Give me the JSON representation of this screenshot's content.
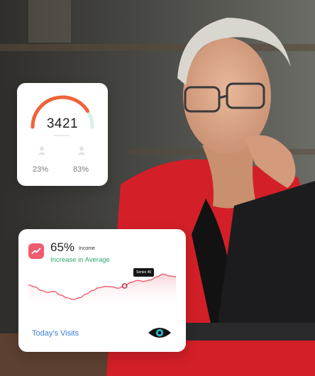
{
  "gauge_card": {
    "value": "3421",
    "gauge_fill": 0.82,
    "stats": [
      {
        "percent": "23%"
      },
      {
        "percent": "83%"
      }
    ],
    "accent_color": "#f0643a"
  },
  "income_card": {
    "percent": "65%",
    "label": "Income",
    "subtitle": "Increase in Average",
    "tooltip": "Series 46",
    "footer_link": "Today's Visits",
    "accent_color": "#ef5b6f",
    "subtitle_color": "#2fa771",
    "link_color": "#3b7fd6",
    "icons": [
      "trend-up-icon",
      "eye-icon"
    ]
  },
  "chart_data": {
    "type": "area",
    "values": [
      52,
      48,
      40,
      36,
      38,
      30,
      24,
      20,
      24,
      32,
      40,
      46,
      49,
      48,
      45,
      50,
      58,
      62,
      60,
      63,
      70,
      76,
      72,
      70
    ],
    "highlight_index": 15,
    "ylim": [
      0,
      100
    ],
    "grid": false
  }
}
